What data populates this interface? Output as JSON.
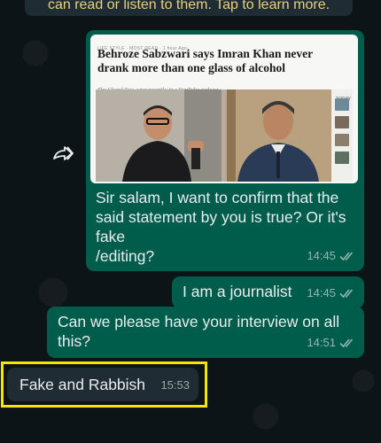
{
  "banner": {
    "text": "can read or listen to them. Tap to learn more."
  },
  "messages": [
    {
      "direction": "outgoing",
      "image": {
        "tags": "LIFE STYLE · MOST READ · 1 hour Ago",
        "headline": "Behroze Sabzwari says Imran Khan never drank more than one glass of alcohol",
        "subline": "The Chand Tara actor recently in a YouTube podcast",
        "side_label": "TODAY"
      },
      "text": "Sir salam, I want to confirm that the said statement by you is true? Or it's fake\n/editing?",
      "time": "14:45",
      "status": "read"
    },
    {
      "direction": "outgoing",
      "text": "I am a journalist",
      "time": "14:45",
      "status": "read"
    },
    {
      "direction": "outgoing",
      "text": "Can we please have your interview on all this?",
      "time": "14:51",
      "status": "read"
    },
    {
      "direction": "incoming",
      "text": "Fake and Rabbish",
      "time": "15:53",
      "highlighted": true
    }
  ],
  "colors": {
    "outgoing_bubble": "#005c4b",
    "incoming_bubble": "#202c33",
    "highlight_box": "#f5e600",
    "banner_text": "#e9d27a"
  },
  "icons": {
    "forward": "forward-arrow-icon",
    "read_receipt": "double-check-icon"
  }
}
